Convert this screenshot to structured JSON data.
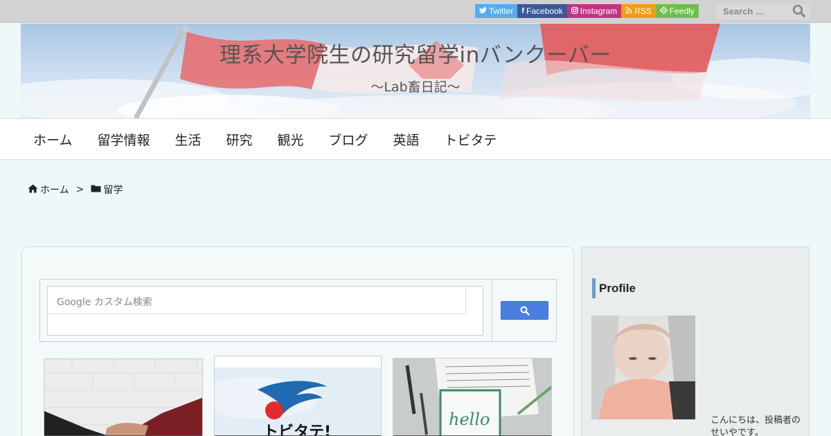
{
  "topbar": {
    "social": [
      {
        "label": "Twitter",
        "icon": "twitter-icon",
        "color": "#55acee"
      },
      {
        "label": "Facebook",
        "icon": "facebook-icon",
        "color": "#3b5998"
      },
      {
        "label": "Instagram",
        "icon": "instagram-icon",
        "color": "#c13584"
      },
      {
        "label": "RSS",
        "icon": "rss-icon",
        "color": "#f39c12"
      },
      {
        "label": "Feedly",
        "icon": "feedly-icon",
        "color": "#6cc04a"
      }
    ],
    "search_placeholder": "Search …"
  },
  "header": {
    "title": "理系大学院生の研究留学inバンクーバー",
    "subtitle": "～Lab畜日記～"
  },
  "nav": {
    "items": [
      "ホーム",
      "留学情報",
      "生活",
      "研究",
      "観光",
      "ブログ",
      "英語",
      "トビタテ"
    ]
  },
  "breadcrumb": {
    "home": "ホーム",
    "separator": ">",
    "category": "留学"
  },
  "custom_search": {
    "placeholder": "Google カスタム検索"
  },
  "sidebar": {
    "heading": "Profile",
    "intro": "こんにちは、投稿者のせいやです。"
  },
  "colors": {
    "accent": "#6a9ad8",
    "background": "#eff8f8"
  }
}
